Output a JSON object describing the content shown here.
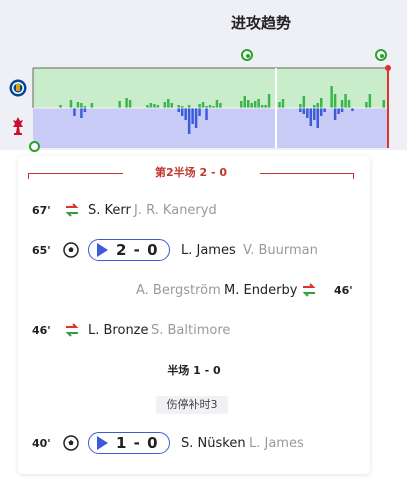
{
  "momentum": {
    "title": "进攻趋势",
    "home_team": "Chelsea",
    "away_team": "Liverpool",
    "home_color": "#c9eccb",
    "away_color": "#c7cbf6",
    "home_bar_color": "#3ab54a",
    "away_bar_color": "#3b5bdb",
    "home_bars": [
      0,
      0,
      0,
      0,
      0,
      0,
      0,
      3,
      0,
      0,
      8,
      0,
      6,
      5,
      2,
      0,
      5,
      0,
      0,
      0,
      0,
      0,
      0,
      0,
      7,
      0,
      10,
      8,
      0,
      0,
      0,
      0,
      3,
      5,
      4,
      3,
      0,
      6,
      9,
      5,
      0,
      3,
      2,
      0,
      3,
      0,
      0,
      4,
      6,
      2,
      3,
      2,
      8,
      5,
      0,
      0,
      0,
      0,
      0,
      7,
      12,
      8,
      5,
      7,
      9,
      3,
      3,
      14,
      0,
      0,
      6,
      9,
      0,
      0,
      0,
      0,
      4,
      12,
      0,
      0,
      3,
      5,
      10,
      0,
      0,
      22,
      14,
      0,
      8,
      14,
      8,
      0,
      0,
      0,
      0,
      6,
      14,
      0,
      0,
      0,
      8
    ],
    "away_bars": [
      0,
      0,
      0,
      0,
      0,
      0,
      0,
      0,
      0,
      0,
      0,
      0,
      0,
      0,
      0,
      0,
      0,
      0,
      0,
      0,
      0,
      0,
      0,
      0,
      4,
      8,
      0,
      0,
      0,
      0,
      0,
      0,
      0,
      0,
      0,
      3,
      0,
      0,
      0,
      0,
      0,
      0,
      0,
      0,
      0,
      0,
      0,
      0,
      0,
      0,
      0,
      0,
      0,
      0,
      0,
      0,
      0,
      0,
      0,
      0,
      0,
      0,
      0,
      0,
      0,
      0,
      0,
      0,
      0,
      0,
      0,
      0,
      0,
      0,
      0,
      0,
      0,
      0,
      0,
      0,
      0,
      0,
      0,
      0,
      0,
      0,
      0,
      0,
      0,
      0,
      0,
      0,
      0,
      0,
      0,
      0,
      0,
      0,
      0,
      0,
      0
    ]
  },
  "timeline": {
    "period_header": "第2半场 2 - 0",
    "events": [
      {
        "type": "sub",
        "minute": "67'",
        "side": "home",
        "player_in": "S. Kerr",
        "player_out": "J. R. Kaneryd"
      },
      {
        "type": "goal",
        "minute": "65'",
        "side": "home",
        "score": "2 - 0",
        "scorer": "L. James",
        "assist": "V. Buurman"
      },
      {
        "type": "sub",
        "minute": "46'",
        "side": "away",
        "player_in": "M. Enderby",
        "player_out": "A. Bergström"
      },
      {
        "type": "sub",
        "minute": "46'",
        "side": "home",
        "player_in": "L. Bronze",
        "player_out": "S. Baltimore"
      }
    ],
    "halftime_label": "半场 1 - 0",
    "stoppage_label": "伤停补时3",
    "events_first_half": [
      {
        "type": "goal",
        "minute": "40'",
        "side": "home",
        "score": "1 - 0",
        "scorer": "S. Nüsken",
        "assist": "L. James"
      }
    ]
  }
}
